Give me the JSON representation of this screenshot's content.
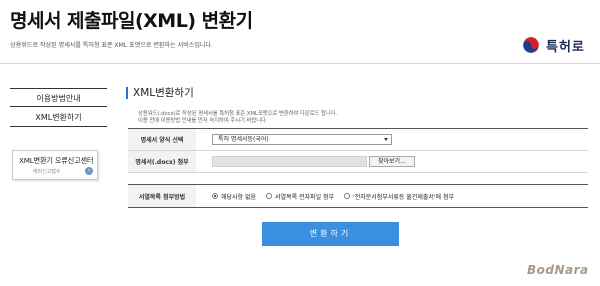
{
  "header": {
    "title": "명세서 제출파일(XML) 변환기",
    "subtitle": "상용워드로 작성된 명세서를 특허청 표준 XML 포맷으로 변환하는 서비스입니다.",
    "logo_text": "특허로"
  },
  "sidebar": {
    "items": [
      {
        "label": "이용방법안내"
      },
      {
        "label": "XML변환하기"
      }
    ],
    "report": {
      "label": "XML변환기 오류신고센터",
      "sub": "에러신고접수"
    }
  },
  "main": {
    "section_title": "XML변환하기",
    "description": [
      "상용워드(.docx)로 작성된 명세서를 특허청 표준 XML포맷으로 변환하여 다운로드 합니다.",
      "이용 전에 이용방법 안내를 먼저 숙지하여 주시기 바랍니다."
    ],
    "form": {
      "spec_type": {
        "label": "명세서 양식 선택",
        "selected": "특허 명세서등(국어)"
      },
      "spec_file": {
        "label": "명세서(.docx) 첨부",
        "browse_label": "찾아보기..."
      },
      "attach_method": {
        "label": "서열목록 첨부방법",
        "options": [
          {
            "label": "해당사항 없음",
            "checked": true
          },
          {
            "label": "서열목록 전자파일 첨부",
            "checked": false
          },
          {
            "label": "'전자문서첨부서류등 물건제출서'에 첨부",
            "checked": false
          }
        ]
      }
    },
    "convert_label": "변환하기"
  },
  "watermark": "BodNara",
  "colors": {
    "accent": "#3a8fe0",
    "section_bar": "#2a74c8"
  }
}
